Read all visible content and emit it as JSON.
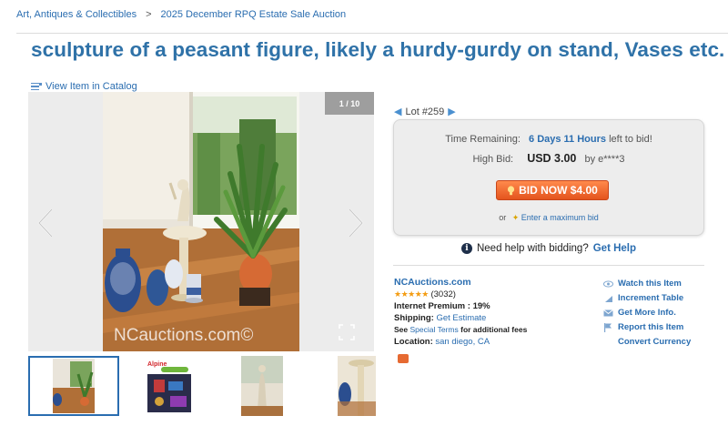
{
  "breadcrumb": {
    "items": [
      "Art, Antiques & Collectibles",
      "2025 December RPQ Estate Sale Auction"
    ],
    "separator": ">"
  },
  "title": "sculpture of a peasant figure, likely a hurdy-gurdy on stand, Vases etc.",
  "view_catalog": "View Item in Catalog",
  "viewer": {
    "counter": "1 / 10",
    "watermark": "NCauctions.com©"
  },
  "thumbs": {
    "thumb2_text": "Alpine"
  },
  "lot": {
    "label": "Lot #259"
  },
  "bid": {
    "time_label": "Time Remaining:",
    "time_value": "6 Days 11 Hours",
    "time_suffix": "left to bid!",
    "high_label": "High Bid:",
    "high_amount": "USD 3.00",
    "high_by": "by e****3",
    "button": "BID NOW $4.00",
    "or": "or",
    "max_link": "Enter a maximum bid"
  },
  "help": {
    "question": "Need help with bidding?",
    "link": "Get Help"
  },
  "seller": {
    "name": "NCAuctions.com",
    "rating_count": "(3032)",
    "premium_label": "Internet Premium :",
    "premium_value": "19%",
    "shipping_label": "Shipping:",
    "shipping_value": "Get Estimate",
    "see": "See",
    "special_terms": "Special Terms",
    "fees": "for additional fees",
    "location_label": "Location:",
    "location_value": "san diego, CA"
  },
  "actions": [
    "Watch this Item",
    "Increment Table",
    "Get More Info.",
    "Report this Item",
    "Convert Currency"
  ],
  "colors": {
    "link": "#2a6db0",
    "title": "#2f72a8",
    "bid_button": "#e4541d"
  }
}
